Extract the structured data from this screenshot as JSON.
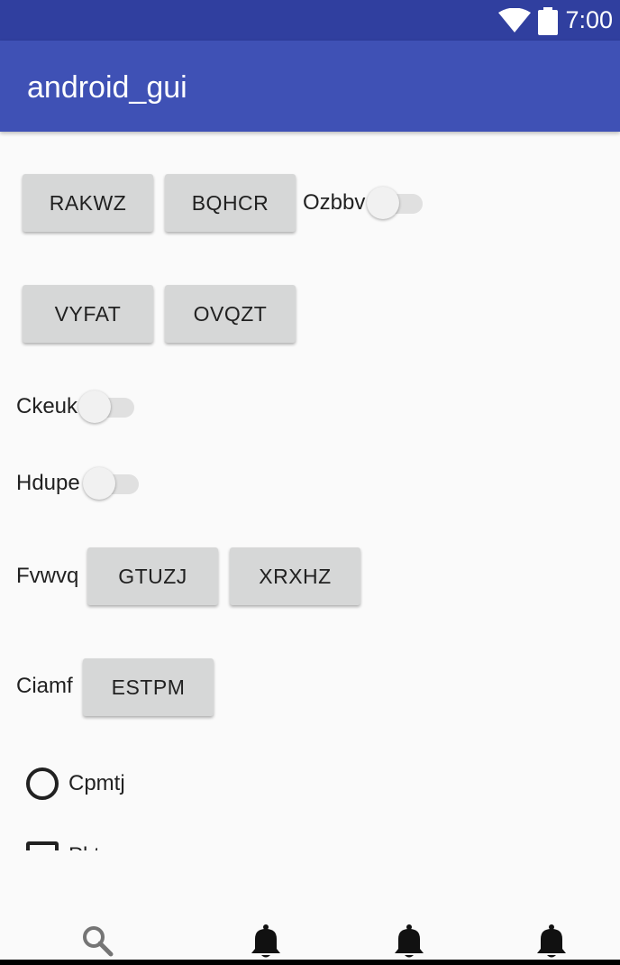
{
  "status_bar": {
    "time": "7:00",
    "wifi_icon": "wifi-icon",
    "battery_icon": "battery-icon"
  },
  "app_bar": {
    "title": "android_gui"
  },
  "content": {
    "row1": {
      "button_1": "RAKWZ",
      "button_2": "BQHCR",
      "switch_label": "Ozbbv",
      "switch_on": false
    },
    "row2": {
      "button_1": "VYFAT",
      "button_2": "OVQZT"
    },
    "switch_ckeuk": {
      "label": "Ckeuk",
      "on": false
    },
    "switch_hdupe": {
      "label": "Hdupe",
      "on": false
    },
    "row_fvwvq": {
      "label": "Fvwvq",
      "button_1": "GTUZJ",
      "button_2": "XRXHZ"
    },
    "row_ciamf": {
      "label": "Ciamf",
      "button": "ESTPM"
    },
    "radio_cpmtj": {
      "label": "Cpmtj",
      "checked": false
    },
    "checkbox_partial": {
      "label": "Pktq"
    }
  },
  "bottom_nav": {
    "items": [
      {
        "icon": "search-icon"
      },
      {
        "icon": "bell-icon"
      },
      {
        "icon": "bell-icon"
      },
      {
        "icon": "bell-icon"
      }
    ]
  }
}
